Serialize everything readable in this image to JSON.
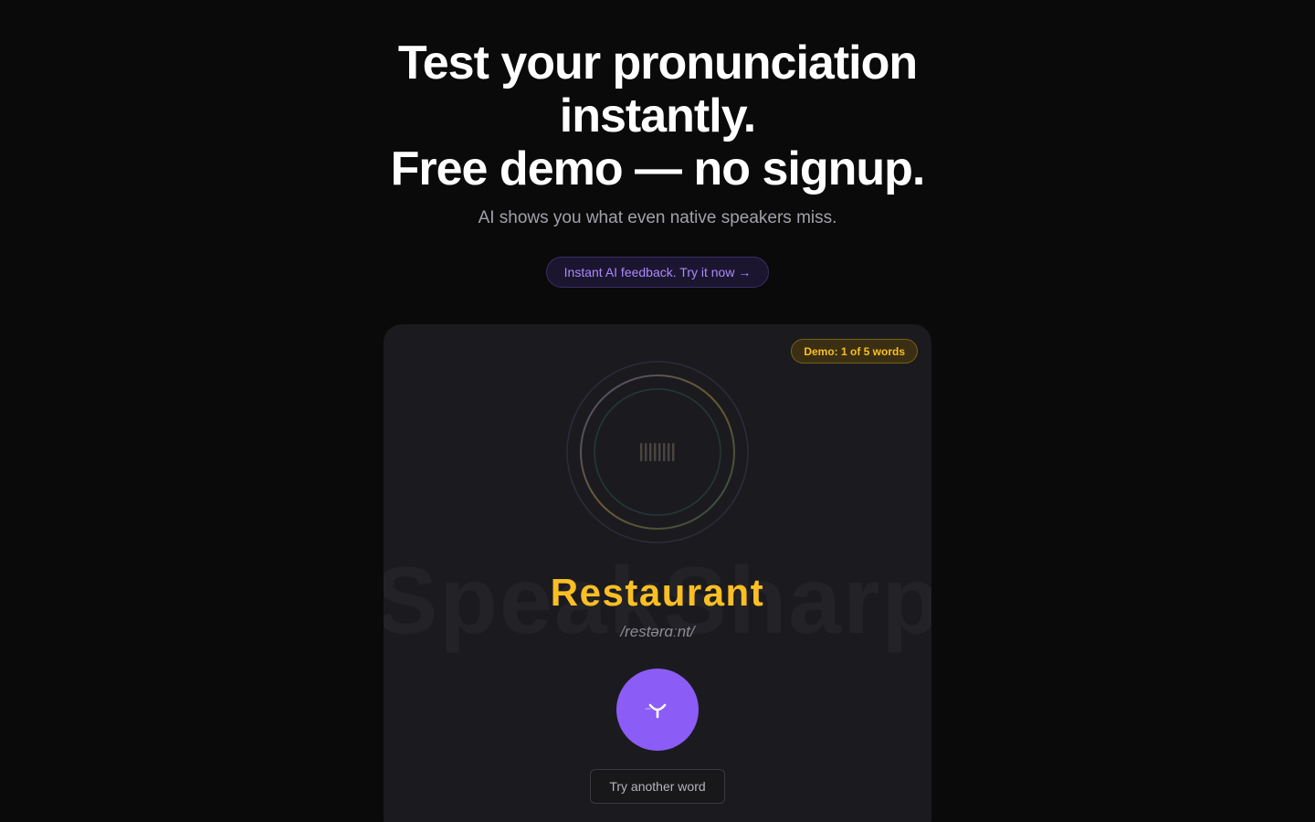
{
  "hero": {
    "title_line1": "Test your pronunciation",
    "title_line2": "instantly.",
    "title_line3": "Free demo — no signup.",
    "subtitle": "AI shows you what even native speakers miss.",
    "cta_label": "Instant AI feedback. Try it now →"
  },
  "demo": {
    "badge": "Demo: 1 of 5 words",
    "watermark": "SpeakSharp",
    "word": "Restaurant",
    "ipa": "/restərɑːnt/",
    "try_another_label": "Try another word"
  },
  "colors": {
    "accent_purple": "#8b5cf6",
    "accent_gold": "#fbbf24",
    "background": "#0a0a0b",
    "card": "#1b1b1f"
  },
  "icons": {
    "record": "microphone-icon",
    "waveform": "waveform-icon"
  }
}
